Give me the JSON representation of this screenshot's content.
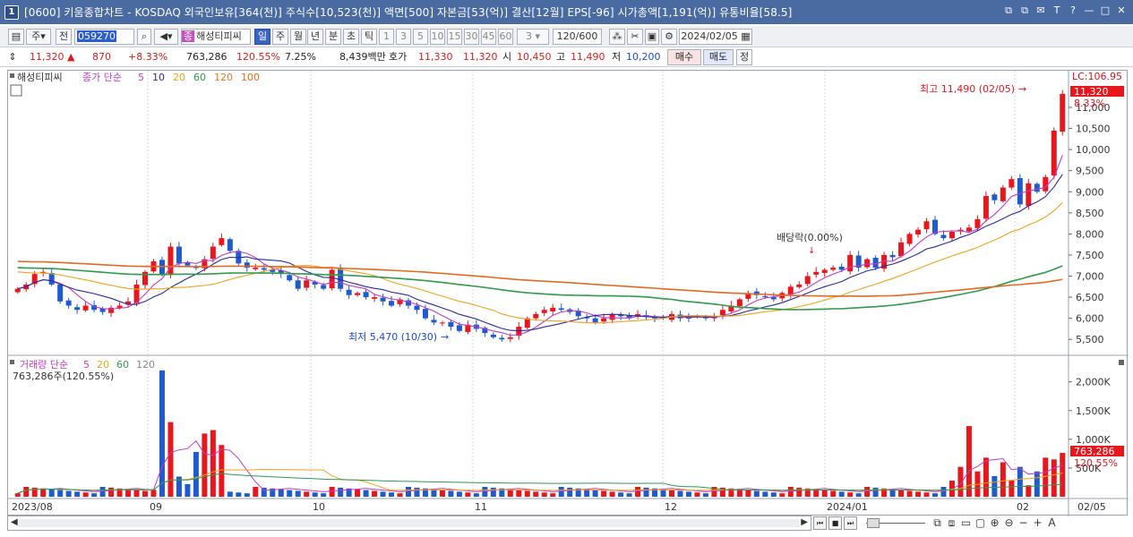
{
  "window": {
    "icon": "1",
    "title": "[0600] 키움종합차트 - KOSDAQ 외국인보유[364(천)] 주식수[10,523(천)] 액면[500] 자본금[53(억)] 결산[12월] EPS[-96] 시가총액[1,191(억)] 유통비율[58.5]",
    "controls": [
      "⧉",
      "⧉",
      "✉",
      "T",
      "?",
      "—",
      "□",
      "✕"
    ]
  },
  "toolbar": {
    "market": "주",
    "prev": "전",
    "code": "059270",
    "name_badge": "종",
    "name": "해성티피씨",
    "periods": [
      "일",
      "주",
      "월",
      "년",
      "분",
      "초",
      "틱"
    ],
    "active_period": "일",
    "intervals": [
      "1",
      "3",
      "5",
      "10",
      "15",
      "30",
      "45",
      "60"
    ],
    "interval_value": "3",
    "count": "120/600",
    "date": "2024/02/05"
  },
  "price_row": {
    "price": "11,320",
    "change": "870",
    "change_pct": "+8.33%",
    "volume": "763,286",
    "volume_ratio": "120.55%",
    "turnover": "7.25%",
    "amount": "8,439백만",
    "ask_label": "호가",
    "ask": "11,330",
    "bid": "11,320",
    "open_label": "시",
    "open": "10,450",
    "high_label": "고",
    "high": "11,490",
    "low_label": "저",
    "low": "10,200",
    "buy_label": "매수",
    "sell_label": "매도",
    "order_label": "정"
  },
  "chart_data": {
    "type": "candlestick",
    "stock_name": "해성티피씨",
    "ma_legend": {
      "label": "종가 단순",
      "periods": [
        "5",
        "10",
        "20",
        "60",
        "120",
        "100"
      ]
    },
    "colors": {
      "up": "#e8161d",
      "down": "#1f5bcc",
      "ma5": "#c13bc6",
      "ma10": "#2a2a9e",
      "ma20": "#f0a21b",
      "ma60": "#2f9a4c",
      "ma120": "#e07a2a",
      "ma100": "#e26a20"
    },
    "price_axis": {
      "ticks": [
        "11,000",
        "10,500",
        "10,000",
        "9,500",
        "9,000",
        "8,500",
        "8,000",
        "7,500",
        "7,000",
        "6,500",
        "6,000",
        "5,500"
      ],
      "range": [
        5250,
        11700
      ],
      "top_label": "LC:106.95"
    },
    "current_price_label": "11,320",
    "current_change_label": "8.33%",
    "x_axis": {
      "labels": [
        "2023/08",
        "09",
        "10",
        "11",
        "12",
        "2024/01",
        "02",
        "02/05"
      ]
    },
    "annotations": {
      "high": "최고 11,490 (02/05)",
      "low": "최저 5,470 (10/30)",
      "dividend": "배당락(0.00%)"
    },
    "volume_panel": {
      "legend": {
        "label": "거래량 단순",
        "periods": [
          "5",
          "20",
          "60",
          "120"
        ]
      },
      "info": "763,286주(120.55%)",
      "axis": [
        "2,000K",
        "1,500K",
        "1,000K",
        "500K"
      ],
      "current_label": "763,286",
      "current_pct": "120.55%"
    },
    "closes": [
      6700,
      6800,
      7050,
      7100,
      6800,
      6400,
      6300,
      6200,
      6300,
      6200,
      6150,
      6250,
      6300,
      6400,
      6800,
      7100,
      7350,
      7050,
      7700,
      7300,
      7250,
      7200,
      7400,
      7700,
      7900,
      7600,
      7300,
      7200,
      7200,
      7150,
      7100,
      7050,
      6900,
      6700,
      6900,
      6800,
      6700,
      7150,
      6700,
      6550,
      6600,
      6500,
      6500,
      6400,
      6300,
      6450,
      6300,
      6200,
      6000,
      5900,
      5900,
      5800,
      5700,
      5850,
      5750,
      5650,
      5550,
      5500,
      5550,
      5800,
      6000,
      6100,
      6200,
      6250,
      6200,
      6150,
      6050,
      6000,
      5900,
      6000,
      6100,
      6050,
      6000,
      6100,
      6050,
      6000,
      6000,
      6100,
      6000,
      6000,
      6050,
      6000,
      6050,
      6200,
      6300,
      6450,
      6600,
      6550,
      6500,
      6450,
      6600,
      6750,
      6800,
      7000,
      7100,
      7150,
      7200,
      7150,
      7500,
      7200,
      7400,
      7200,
      7500,
      7450,
      7800,
      8000,
      8100,
      8300,
      8000,
      7900,
      8050,
      8100,
      8150,
      8350,
      8900,
      8800,
      9100,
      9300,
      8700,
      9200,
      9000,
      9350,
      10450,
      11320
    ]
  }
}
